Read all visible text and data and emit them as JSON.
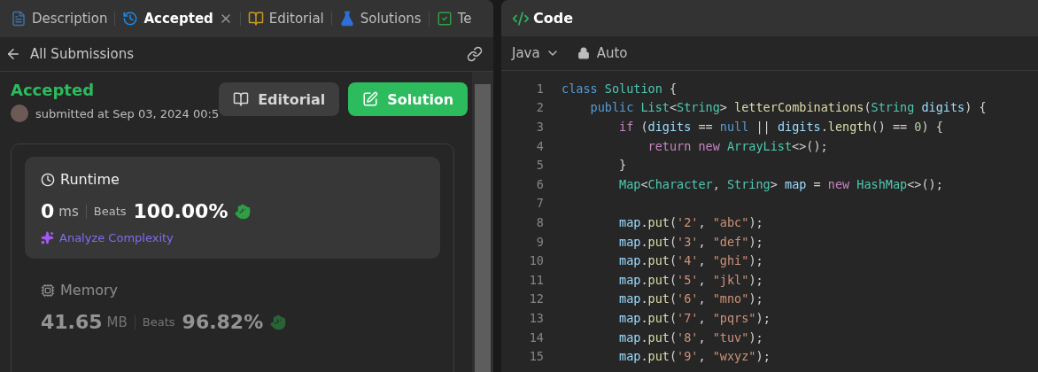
{
  "tabs": [
    {
      "label": "Description",
      "kind": "description",
      "selected": false,
      "closable": false
    },
    {
      "label": "Accepted",
      "kind": "history",
      "selected": true,
      "closable": true
    },
    {
      "label": "Editorial",
      "kind": "editorial",
      "selected": false,
      "closable": false
    },
    {
      "label": "Solutions",
      "kind": "solutions",
      "selected": false,
      "closable": false
    },
    {
      "label": "Te",
      "kind": "testcase",
      "selected": false,
      "closable": false
    }
  ],
  "header": {
    "back_label": "All Submissions"
  },
  "submission": {
    "status": "Accepted",
    "submitted": "submitted at Sep 03, 2024 00:5",
    "buttons": [
      {
        "label": "Editorial",
        "kind": "editorial"
      },
      {
        "label": "Solution",
        "kind": "solution"
      }
    ]
  },
  "metrics": [
    {
      "title": "Runtime",
      "kind": "runtime",
      "selected": true,
      "value": "0",
      "unit": "ms",
      "beats_label": "Beats",
      "percent": "100.00%",
      "link": "Analyze Complexity"
    },
    {
      "title": "Memory",
      "kind": "memory",
      "selected": false,
      "value": "41.65",
      "unit": "MB",
      "beats_label": "Beats",
      "percent": "96.82%"
    }
  ],
  "code_panel": {
    "title": "Code",
    "language": "Java",
    "mode": "Auto",
    "lines": [
      {
        "number": "1",
        "tokens": [
          {
            "text": "class ",
            "kind": "keyword"
          },
          {
            "text": "Solution",
            "kind": "type"
          },
          {
            "text": " {",
            "kind": "plain"
          }
        ]
      },
      {
        "number": "2",
        "tokens": [
          {
            "text": "    public ",
            "kind": "keyword"
          },
          {
            "text": "List",
            "kind": "type"
          },
          {
            "text": "<",
            "kind": "plain"
          },
          {
            "text": "String",
            "kind": "type"
          },
          {
            "text": "> ",
            "kind": "plain"
          },
          {
            "text": "letterCombinations",
            "kind": "func"
          },
          {
            "text": "(",
            "kind": "plain"
          },
          {
            "text": "String ",
            "kind": "type"
          },
          {
            "text": "digits",
            "kind": "var"
          },
          {
            "text": ") {",
            "kind": "plain"
          }
        ]
      },
      {
        "number": "3",
        "tokens": [
          {
            "text": "        if ",
            "kind": "control"
          },
          {
            "text": "(",
            "kind": "plain"
          },
          {
            "text": "digits",
            "kind": "var"
          },
          {
            "text": " == ",
            "kind": "plain"
          },
          {
            "text": "null",
            "kind": "keyword"
          },
          {
            "text": " || ",
            "kind": "plain"
          },
          {
            "text": "digits",
            "kind": "var"
          },
          {
            "text": ".",
            "kind": "plain"
          },
          {
            "text": "length",
            "kind": "func"
          },
          {
            "text": "() == ",
            "kind": "plain"
          },
          {
            "text": "0",
            "kind": "number"
          },
          {
            "text": ") {",
            "kind": "plain"
          }
        ]
      },
      {
        "number": "4",
        "tokens": [
          {
            "text": "            return new ",
            "kind": "control"
          },
          {
            "text": "ArrayList",
            "kind": "type"
          },
          {
            "text": "<>();",
            "kind": "plain"
          }
        ]
      },
      {
        "number": "5",
        "tokens": [
          {
            "text": "        }",
            "kind": "plain"
          }
        ]
      },
      {
        "number": "6",
        "tokens": [
          {
            "text": "        Map",
            "kind": "type"
          },
          {
            "text": "<",
            "kind": "plain"
          },
          {
            "text": "Character",
            "kind": "type"
          },
          {
            "text": ", ",
            "kind": "plain"
          },
          {
            "text": "String",
            "kind": "type"
          },
          {
            "text": "> ",
            "kind": "plain"
          },
          {
            "text": "map",
            "kind": "var"
          },
          {
            "text": " = ",
            "kind": "plain"
          },
          {
            "text": "new ",
            "kind": "control"
          },
          {
            "text": "HashMap",
            "kind": "type"
          },
          {
            "text": "<>();",
            "kind": "plain"
          }
        ]
      },
      {
        "number": "7"
      },
      {
        "number": "8",
        "tokens": [
          {
            "text": "        map",
            "kind": "var"
          },
          {
            "text": ".",
            "kind": "plain"
          },
          {
            "text": "put",
            "kind": "func"
          },
          {
            "text": "(",
            "kind": "plain"
          },
          {
            "text": "'2'",
            "kind": "string"
          },
          {
            "text": ", ",
            "kind": "plain"
          },
          {
            "text": "\"abc\"",
            "kind": "string"
          },
          {
            "text": ");",
            "kind": "plain"
          }
        ]
      },
      {
        "number": "9",
        "tokens": [
          {
            "text": "        map",
            "kind": "var"
          },
          {
            "text": ".",
            "kind": "plain"
          },
          {
            "text": "put",
            "kind": "func"
          },
          {
            "text": "(",
            "kind": "plain"
          },
          {
            "text": "'3'",
            "kind": "string"
          },
          {
            "text": ", ",
            "kind": "plain"
          },
          {
            "text": "\"def\"",
            "kind": "string"
          },
          {
            "text": ");",
            "kind": "plain"
          }
        ]
      },
      {
        "number": "10",
        "tokens": [
          {
            "text": "        map",
            "kind": "var"
          },
          {
            "text": ".",
            "kind": "plain"
          },
          {
            "text": "put",
            "kind": "func"
          },
          {
            "text": "(",
            "kind": "plain"
          },
          {
            "text": "'4'",
            "kind": "string"
          },
          {
            "text": ", ",
            "kind": "plain"
          },
          {
            "text": "\"ghi\"",
            "kind": "string"
          },
          {
            "text": ");",
            "kind": "plain"
          }
        ]
      },
      {
        "number": "11",
        "tokens": [
          {
            "text": "        map",
            "kind": "var"
          },
          {
            "text": ".",
            "kind": "plain"
          },
          {
            "text": "put",
            "kind": "func"
          },
          {
            "text": "(",
            "kind": "plain"
          },
          {
            "text": "'5'",
            "kind": "string"
          },
          {
            "text": ", ",
            "kind": "plain"
          },
          {
            "text": "\"jkl\"",
            "kind": "string"
          },
          {
            "text": ");",
            "kind": "plain"
          }
        ]
      },
      {
        "number": "12",
        "tokens": [
          {
            "text": "        map",
            "kind": "var"
          },
          {
            "text": ".",
            "kind": "plain"
          },
          {
            "text": "put",
            "kind": "func"
          },
          {
            "text": "(",
            "kind": "plain"
          },
          {
            "text": "'6'",
            "kind": "string"
          },
          {
            "text": ", ",
            "kind": "plain"
          },
          {
            "text": "\"mno\"",
            "kind": "string"
          },
          {
            "text": ");",
            "kind": "plain"
          }
        ]
      },
      {
        "number": "13",
        "tokens": [
          {
            "text": "        map",
            "kind": "var"
          },
          {
            "text": ".",
            "kind": "plain"
          },
          {
            "text": "put",
            "kind": "func"
          },
          {
            "text": "(",
            "kind": "plain"
          },
          {
            "text": "'7'",
            "kind": "string"
          },
          {
            "text": ", ",
            "kind": "plain"
          },
          {
            "text": "\"pqrs\"",
            "kind": "string"
          },
          {
            "text": ");",
            "kind": "plain"
          }
        ]
      },
      {
        "number": "14",
        "tokens": [
          {
            "text": "        map",
            "kind": "var"
          },
          {
            "text": ".",
            "kind": "plain"
          },
          {
            "text": "put",
            "kind": "func"
          },
          {
            "text": "(",
            "kind": "plain"
          },
          {
            "text": "'8'",
            "kind": "string"
          },
          {
            "text": ", ",
            "kind": "plain"
          },
          {
            "text": "\"tuv\"",
            "kind": "string"
          },
          {
            "text": ");",
            "kind": "plain"
          }
        ]
      },
      {
        "number": "15",
        "tokens": [
          {
            "text": "        map",
            "kind": "var"
          },
          {
            "text": ".",
            "kind": "plain"
          },
          {
            "text": "put",
            "kind": "func"
          },
          {
            "text": "(",
            "kind": "plain"
          },
          {
            "text": "'9'",
            "kind": "string"
          },
          {
            "text": ", ",
            "kind": "plain"
          },
          {
            "text": "\"wxyz\"",
            "kind": "string"
          },
          {
            "text": ");",
            "kind": "plain"
          }
        ]
      }
    ]
  }
}
